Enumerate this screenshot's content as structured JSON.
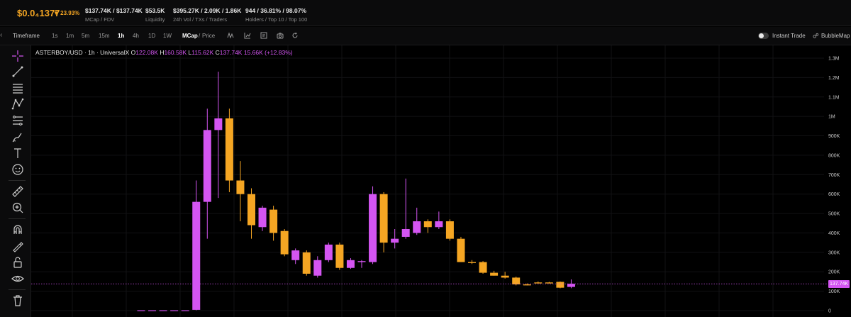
{
  "stats": {
    "price": "$0.0₄1377",
    "change": "▼ 23.93%",
    "mcap": {
      "value": "$137.74K / $137.74K",
      "label": "MCap / FDV"
    },
    "liquidity": {
      "value": "$53.5K",
      "label": "Liquidity"
    },
    "volume": {
      "value": "$395.27K / 2.09K / 1.86K",
      "label": "24h Vol / TXs / Traders"
    },
    "holders": {
      "value": "944 / 36.81% / 98.07%",
      "label": "Holders / Top 10 / Top 100"
    }
  },
  "toolbar": {
    "timeframe_label": "Timeframe",
    "intervals": [
      "1s",
      "1m",
      "5m",
      "15m",
      "1h",
      "4h",
      "1D",
      "1W"
    ],
    "active_interval": "1h",
    "mcap_label": "MCap",
    "separator": "/",
    "price_label": "Price",
    "instant_trade_label": "Instant Trade",
    "bubblemap_label": "BubbleMap"
  },
  "icons": [
    "indicators-icon",
    "chart-type-icon",
    "layout-icon",
    "camera-icon",
    "reset-icon",
    "bubblemap-icon"
  ],
  "tools": [
    "crosshair-icon",
    "trendline-icon",
    "horizontal-lines-icon",
    "pattern-icon",
    "fib-icon",
    "brush-icon",
    "text-icon",
    "emoji-icon",
    "ruler-icon",
    "zoom-in-icon",
    "magnet-icon",
    "lock-draw-icon",
    "lock-icon",
    "eye-icon",
    "trash-icon"
  ],
  "legend": {
    "symbol": "ASTERBOY/USD · 1h · UniversalX",
    "o_label": "O",
    "o": "122.08K",
    "h_label": "H",
    "h": "160.58K",
    "l_label": "L",
    "l": "115.62K",
    "c_label": "C",
    "c": "137.74K",
    "change": "15.66K (+12.83%)"
  },
  "current_price_tag": "137.74K",
  "colors": {
    "up": "#d455f2",
    "down": "#f5a623",
    "background": "#000000",
    "price_accent": "#f5a623"
  },
  "chart_data": {
    "type": "candlestick",
    "y_unit": "market cap (USD)",
    "ylim": [
      0,
      1350000
    ],
    "y_ticks": [
      {
        "v": 0,
        "label": "0"
      },
      {
        "v": 100000,
        "label": "100K"
      },
      {
        "v": 200000,
        "label": "200K"
      },
      {
        "v": 300000,
        "label": "300K"
      },
      {
        "v": 400000,
        "label": "400K"
      },
      {
        "v": 500000,
        "label": "500K"
      },
      {
        "v": 600000,
        "label": "600K"
      },
      {
        "v": 700000,
        "label": "700K"
      },
      {
        "v": 800000,
        "label": "800K"
      },
      {
        "v": 900000,
        "label": "900K"
      },
      {
        "v": 1000000,
        "label": "1M"
      },
      {
        "v": 1100000,
        "label": "1.1M"
      },
      {
        "v": 1200000,
        "label": "1.2M"
      },
      {
        "v": 1300000,
        "label": "1.3M"
      }
    ],
    "grid": true,
    "last_price": 137740,
    "candles": [
      {
        "o": 2000,
        "h": 2000,
        "l": 2000,
        "c": 2000
      },
      {
        "o": 2000,
        "h": 2000,
        "l": 2000,
        "c": 2000
      },
      {
        "o": 2000,
        "h": 2000,
        "l": 2000,
        "c": 2000
      },
      {
        "o": 2000,
        "h": 2000,
        "l": 2000,
        "c": 2000
      },
      {
        "o": 2000,
        "h": 2000,
        "l": 2000,
        "c": 2000
      },
      {
        "o": 4000,
        "h": 670000,
        "l": 2000,
        "c": 560000
      },
      {
        "o": 560000,
        "h": 1040000,
        "l": 370000,
        "c": 930000
      },
      {
        "o": 930000,
        "h": 1230000,
        "l": 580000,
        "c": 990000
      },
      {
        "o": 990000,
        "h": 1040000,
        "l": 610000,
        "c": 670000
      },
      {
        "o": 670000,
        "h": 770000,
        "l": 460000,
        "c": 600000
      },
      {
        "o": 600000,
        "h": 630000,
        "l": 370000,
        "c": 440000
      },
      {
        "o": 430000,
        "h": 540000,
        "l": 410000,
        "c": 530000
      },
      {
        "o": 520000,
        "h": 540000,
        "l": 360000,
        "c": 400000
      },
      {
        "o": 410000,
        "h": 420000,
        "l": 280000,
        "c": 290000
      },
      {
        "o": 260000,
        "h": 320000,
        "l": 240000,
        "c": 310000
      },
      {
        "o": 300000,
        "h": 310000,
        "l": 180000,
        "c": 190000
      },
      {
        "o": 180000,
        "h": 280000,
        "l": 170000,
        "c": 260000
      },
      {
        "o": 260000,
        "h": 350000,
        "l": 250000,
        "c": 340000
      },
      {
        "o": 340000,
        "h": 350000,
        "l": 210000,
        "c": 220000
      },
      {
        "o": 220000,
        "h": 270000,
        "l": 215000,
        "c": 260000
      },
      {
        "o": 250000,
        "h": 260000,
        "l": 220000,
        "c": 255000
      },
      {
        "o": 250000,
        "h": 640000,
        "l": 240000,
        "c": 600000
      },
      {
        "o": 600000,
        "h": 610000,
        "l": 300000,
        "c": 350000
      },
      {
        "o": 350000,
        "h": 420000,
        "l": 320000,
        "c": 370000
      },
      {
        "o": 380000,
        "h": 680000,
        "l": 370000,
        "c": 420000
      },
      {
        "o": 400000,
        "h": 530000,
        "l": 390000,
        "c": 460000
      },
      {
        "o": 460000,
        "h": 470000,
        "l": 400000,
        "c": 430000
      },
      {
        "o": 430000,
        "h": 510000,
        "l": 420000,
        "c": 460000
      },
      {
        "o": 460000,
        "h": 470000,
        "l": 360000,
        "c": 370000
      },
      {
        "o": 370000,
        "h": 380000,
        "l": 250000,
        "c": 250000
      },
      {
        "o": 250000,
        "h": 260000,
        "l": 240000,
        "c": 245000
      },
      {
        "o": 250000,
        "h": 255000,
        "l": 190000,
        "c": 195000
      },
      {
        "o": 195000,
        "h": 205000,
        "l": 180000,
        "c": 180000
      },
      {
        "o": 180000,
        "h": 200000,
        "l": 165000,
        "c": 170000
      },
      {
        "o": 170000,
        "h": 175000,
        "l": 130000,
        "c": 135000
      },
      {
        "o": 135000,
        "h": 140000,
        "l": 130000,
        "c": 130000
      },
      {
        "o": 145000,
        "h": 150000,
        "l": 140000,
        "c": 140000
      },
      {
        "o": 145000,
        "h": 148000,
        "l": 140000,
        "c": 140000
      },
      {
        "o": 148000,
        "h": 150000,
        "l": 115000,
        "c": 118000
      },
      {
        "o": 122080,
        "h": 160580,
        "l": 115620,
        "c": 137740
      }
    ]
  }
}
